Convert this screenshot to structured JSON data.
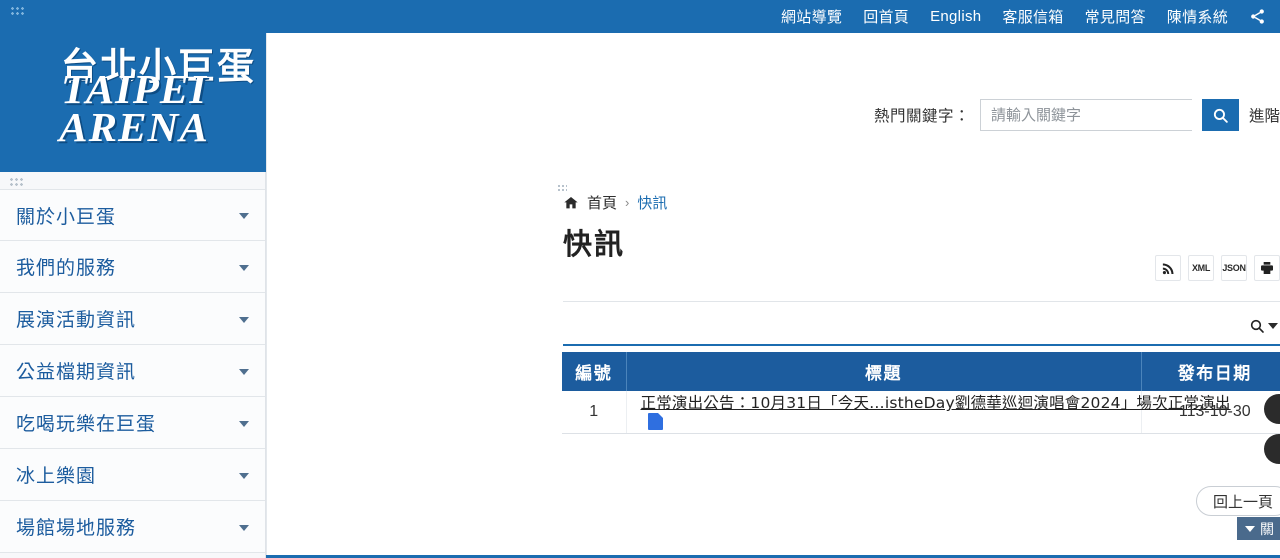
{
  "topbar": {
    "links": [
      {
        "label": "網站導覽"
      },
      {
        "label": "回首頁"
      },
      {
        "label": "English"
      },
      {
        "label": "客服信箱"
      },
      {
        "label": "常見問答"
      },
      {
        "label": "陳情系統"
      }
    ],
    "share_icon": "share-icon"
  },
  "logo": {
    "chinese": "台北小巨蛋",
    "english": "TAIPEI ARENA"
  },
  "search": {
    "label": "熱門關鍵字：",
    "placeholder": "請輸入關鍵字",
    "value": "",
    "submit_icon": "search-icon",
    "advanced_label": "進階"
  },
  "sidebar": {
    "items": [
      {
        "label": "關於小巨蛋"
      },
      {
        "label": "我們的服務"
      },
      {
        "label": "展演活動資訊"
      },
      {
        "label": "公益檔期資訊"
      },
      {
        "label": "吃喝玩樂在巨蛋"
      },
      {
        "label": "冰上樂園"
      },
      {
        "label": "場館場地服務"
      }
    ]
  },
  "breadcrumb": {
    "home_icon": "home-icon",
    "home_label": "首頁",
    "separator": "›",
    "current": "快訊"
  },
  "page": {
    "title": "快訊"
  },
  "format_buttons": [
    {
      "label": "",
      "icon": "rss-icon"
    },
    {
      "label": "XML",
      "icon": "xml-icon"
    },
    {
      "label": "JSON",
      "icon": "json-icon"
    },
    {
      "label": "",
      "icon": "printer-icon"
    }
  ],
  "filter": {
    "icon": "search-icon",
    "caret": "chevron-down-icon"
  },
  "table": {
    "columns": [
      "編號",
      "標題",
      "發布日期"
    ],
    "rows": [
      {
        "no": "1",
        "title": "正常演出公告：10月31日「今天…istheDay劉德華巡迴演唱會2024」場次正常演出",
        "badge_icon": "share-document-icon",
        "date": "113-10-30"
      }
    ]
  },
  "actions": {
    "back_label": "回上一頁"
  },
  "close_tab": {
    "label": "關",
    "caret": "chevron-down-icon"
  },
  "colors": {
    "brand_blue": "#1b6cb0",
    "table_header_blue": "#1c5c9e",
    "link_blue": "#1b6cb0",
    "badge_blue": "#2f6fe0"
  }
}
